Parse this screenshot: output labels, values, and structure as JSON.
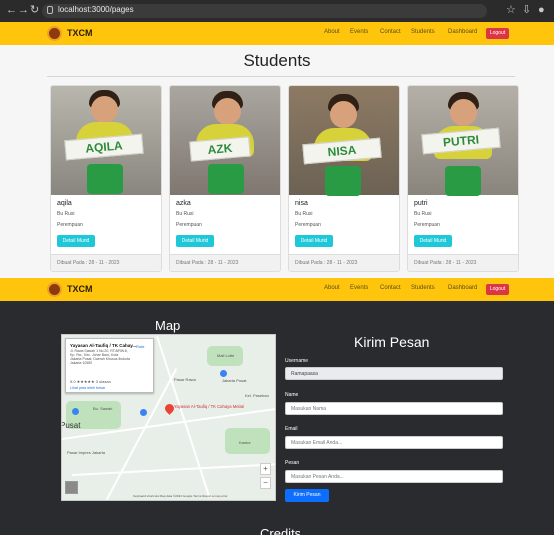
{
  "browser": {
    "url": "localhost:3000/pages"
  },
  "nav": {
    "brand": "TXCM",
    "links": [
      "About",
      "Events",
      "Contact",
      "Students",
      "Dashboard"
    ],
    "logout": "Logout"
  },
  "students": {
    "title": "Students",
    "cards": [
      {
        "name": "aqila",
        "teacher": "Bu Rusi",
        "gender": "Perempuan",
        "button": "Detail Murid",
        "created": "Dibuat Pada : 28 - 11 - 2023",
        "sign": "AQILA"
      },
      {
        "name": "azka",
        "teacher": "Bu Rusi",
        "gender": "Perempuan",
        "button": "Detail Murid",
        "created": "Dibuat Pada : 28 - 11 - 2023",
        "sign": "AZK"
      },
      {
        "name": "nisa",
        "teacher": "Bu Rusi",
        "gender": "Perempuan",
        "button": "Detail Murid",
        "created": "Dibuat Pada : 28 - 11 - 2023",
        "sign": "NISA"
      },
      {
        "name": "putri",
        "teacher": "Bu Rusi",
        "gender": "Perempuan",
        "button": "Detail Murid",
        "created": "Dibuat Pada : 28 - 11 - 2023",
        "sign": "PUTRI"
      }
    ]
  },
  "map": {
    "title": "Map",
    "place": "Yayasan Al-Taufiq / TK Cahay...",
    "address": "Jl. Rawa Sawah 1 No.20, RT.8/RW.8, Kp. Rw., Kec. Johar Baru, Kota Jakarta Pusat, Daerah Khusus Ibukota Jakarta 10550",
    "rating": "5.0 ★★★★★ 3 ulasan",
    "larger_map": "Lihat peta lebih besar",
    "route": "Rute",
    "pin": "Yayasan Al-Taufiq / TK Cahaya Melati",
    "labels": [
      "Pusat",
      "Mall Lotte",
      "Bu. Sawah",
      "Pasar Rawa",
      "Jakarta Pusat",
      "Kantor",
      "Pasar Impres Jakarta",
      "Kel. Paseban"
    ],
    "footer": "Keyboard shortcuts  Map data ©2024 Google  Terms  Report a map error"
  },
  "form": {
    "title": "Kirim Pesan",
    "username_label": "Username",
    "username_value": "Ramapaasa",
    "name_label": "Name",
    "name_placeholder": "Masukan Nama",
    "email_label": "Email",
    "email_placeholder": "Masukan Email Anda...",
    "message_label": "Pesan",
    "message_placeholder": "Masukan Pesan Anda...",
    "submit": "Kirim Pesan"
  },
  "next_section": "Credits"
}
